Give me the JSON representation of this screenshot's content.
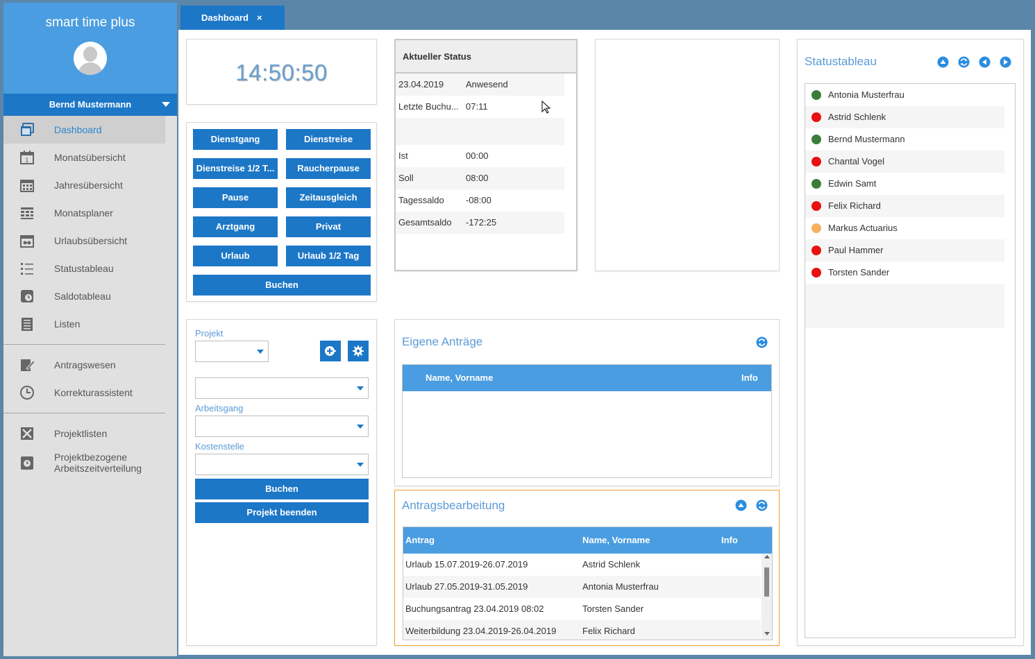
{
  "app": {
    "title": "smart time plus",
    "user": "Bernd Mustermann"
  },
  "nav": {
    "items": [
      {
        "label": "Dashboard",
        "icon": "dashboard-icon"
      },
      {
        "label": "Monatsübersicht",
        "icon": "calendar-month-icon"
      },
      {
        "label": "Jahresübersicht",
        "icon": "calendar-year-icon"
      },
      {
        "label": "Monatsplaner",
        "icon": "planner-icon"
      },
      {
        "label": "Urlaubsübersicht",
        "icon": "vacation-icon"
      },
      {
        "label": "Statustableau",
        "icon": "list-icon"
      },
      {
        "label": "Saldotableau",
        "icon": "balance-icon"
      },
      {
        "label": "Listen",
        "icon": "lists-icon"
      },
      {
        "label": "Antragswesen",
        "icon": "edit-icon"
      },
      {
        "label": "Korrekturassistent",
        "icon": "clock-icon"
      },
      {
        "label": "Projektlisten",
        "icon": "tools-icon"
      },
      {
        "label": "Projektbezogene",
        "label2": "Arbeitszeitverteilung",
        "icon": "project-time-icon"
      }
    ]
  },
  "tabs": [
    {
      "label": "Dashboard",
      "close": "×"
    }
  ],
  "clock": {
    "time": "14:50:50"
  },
  "booking": {
    "buttons": [
      "Dienstgang",
      "Dienstreise",
      "Dienstreise 1/2 T...",
      "Raucherpause",
      "Pause",
      "Zeitausgleich",
      "Arztgang",
      "Privat",
      "Urlaub",
      "Urlaub 1/2 Tag"
    ],
    "submit": "Buchen"
  },
  "status": {
    "title": "Aktueller Status",
    "rows": [
      {
        "k": "23.04.2019",
        "v": "Anwesend"
      },
      {
        "k": "Letzte Buchu...",
        "v": "07:11"
      },
      {
        "k": "",
        "v": ""
      },
      {
        "k": "Ist",
        "v": "00:00"
      },
      {
        "k": "Soll",
        "v": "08:00"
      },
      {
        "k": "Tagessaldo",
        "v": "-08:00"
      },
      {
        "k": "Gesamtsaldo",
        "v": "-172:25"
      }
    ]
  },
  "project": {
    "label_project": "Projekt",
    "label_workstep": "Arbeitsgang",
    "label_cost": "Kostenstelle",
    "book": "Buchen",
    "end": "Projekt beenden"
  },
  "own_requests": {
    "title": "Eigene Anträge",
    "col_name": "Name, Vorname",
    "col_info": "Info"
  },
  "requests": {
    "title": "Antragsbearbeitung",
    "col_request": "Antrag",
    "col_name": "Name, Vorname",
    "col_info": "Info",
    "rows": [
      {
        "request": "Urlaub 15.07.2019-26.07.2019",
        "name": "Astrid Schlenk"
      },
      {
        "request": "Urlaub 27.05.2019-31.05.2019",
        "name": "Antonia Musterfrau"
      },
      {
        "request": "Buchungsantrag 23.04.2019 08:02",
        "name": "Torsten Sander"
      },
      {
        "request": "Weiterbildung 23.04.2019-26.04.2019",
        "name": "Felix Richard"
      }
    ]
  },
  "tableau": {
    "title": "Statustableau",
    "people": [
      {
        "name": "Antonia Musterfrau",
        "color": "#3a7d3a"
      },
      {
        "name": "Astrid Schlenk",
        "color": "#e81010"
      },
      {
        "name": "Bernd Mustermann",
        "color": "#3a7d3a"
      },
      {
        "name": "Chantal Vogel",
        "color": "#e81010"
      },
      {
        "name": "Edwin Samt",
        "color": "#3a7d3a"
      },
      {
        "name": "Felix Richard",
        "color": "#e81010"
      },
      {
        "name": "Markus Actuarius",
        "color": "#f5b060"
      },
      {
        "name": "Paul Hammer",
        "color": "#e81010"
      },
      {
        "name": "Torsten Sander",
        "color": "#e81010"
      }
    ]
  },
  "colors": {
    "accent": "#1d77c7",
    "brand": "#4a9de0",
    "present": "#3a7d3a",
    "absent": "#e81010",
    "partial": "#f5b060"
  }
}
